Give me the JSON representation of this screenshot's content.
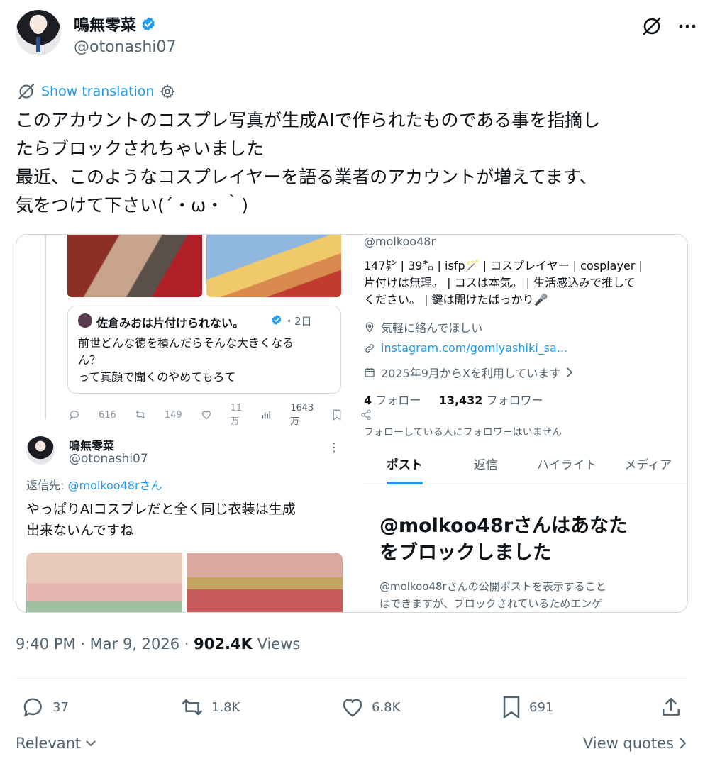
{
  "author": {
    "display_name": "鳴無零菜",
    "handle": "@otonashi07"
  },
  "translation": {
    "label": "Show translation"
  },
  "tweet": {
    "text": "このアカウントのコスプレ写真が生成AIで作られたものである事を指摘し\nたらブロックされちゃいました\n最近、このようなコスプレイヤーを語る業者のアカウントが増えてます、\n気をつけて下さい(´・ω・｀)"
  },
  "screenshot": {
    "quoted": {
      "name": "佐倉みおは片付けられない。",
      "time": "・2日",
      "text": "前世どんな徳を積んだらそんな大きくなる\nん？\nって真顔で聞くのやめてもろて",
      "metrics": [
        "616",
        "149",
        "11万",
        "1643万"
      ]
    },
    "reply": {
      "name": "鳴無零菜",
      "handle": "@otonashi07",
      "reply_prefix": "返信先:",
      "reply_to": "@molkoo48rさん",
      "text": "やっぱりAIコスプレだと全く同じ衣装は生成\n出来ないんですね"
    },
    "profile": {
      "handle": "@molkoo48r",
      "bio": "147㌢ | 39㌔ | isfp🪄 | コスプレイヤー | cosplayer |\n片付けは無理。 | コスは本気。 | 生活感込みで推して\nください。 | 鍵は開けたばっかり🎤",
      "location": "気軽に絡んでほしい",
      "link": "instagram.com/gomiyashiki_sa...",
      "joined": "2025年9月からXを利用しています",
      "following_count": "4",
      "following_label": "フォロー",
      "followers_count": "13,432",
      "followers_label": "フォロワー",
      "no_mutuals": "フォローしている人にフォロワーはいません",
      "tabs": [
        "ポスト",
        "返信",
        "ハイライト",
        "メディア"
      ],
      "blocked_title": "@molkoo48rさんはあなた\nをブロックしました",
      "blocked_body": "@molkoo48rさんの公開ポストを表示すること\nはできますが、ブロックされているためエンゲ"
    }
  },
  "meta": {
    "time": "9:40 PM",
    "date": "Mar 9, 2026",
    "views_count": "902.4K",
    "views_label": "Views"
  },
  "actions": {
    "replies": "37",
    "reposts": "1.8K",
    "likes": "6.8K",
    "bookmarks": "691"
  },
  "footer": {
    "sort_label": "Relevant",
    "view_quotes": "View quotes"
  },
  "colors": {
    "accent": "#1d9bf0",
    "secondary_text": "#536471",
    "text": "#0f1419"
  },
  "icons": [
    "verified-badge-icon",
    "grok-icon",
    "more-icon",
    "translate-icon",
    "settings-icon",
    "reply-icon",
    "repost-icon",
    "like-icon",
    "bookmark-icon",
    "share-icon",
    "chevron-down-icon",
    "chevron-right-icon"
  ]
}
